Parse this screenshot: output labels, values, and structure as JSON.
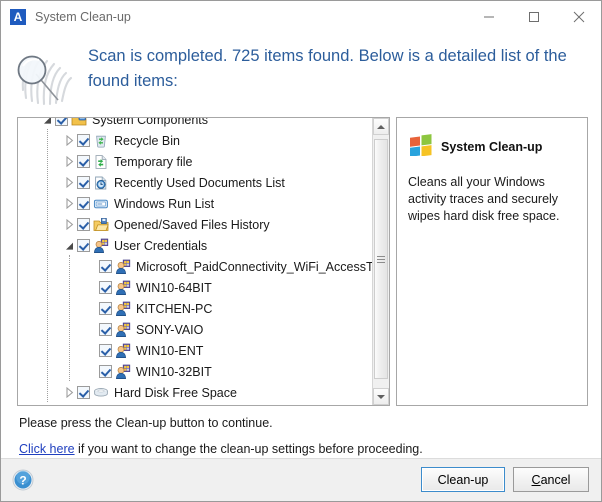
{
  "window": {
    "title": "System Clean-up",
    "app_icon": "letter-a-icon",
    "caption": {
      "minimize": "minimize-icon",
      "maximize": "maximize-icon",
      "close": "close-icon"
    }
  },
  "header": {
    "icon": "fingerprint-magnifier-icon",
    "message": "Scan is completed. 725 items found. Below is a detailed list of the found items:",
    "items_found": 725,
    "text_color": "#2c5d9b"
  },
  "tree": {
    "rows": [
      {
        "label": "System Components",
        "depth": 0,
        "expander": "expanded",
        "checked": true,
        "icon": "system-components-icon",
        "clipped": true
      },
      {
        "label": "Recycle Bin",
        "depth": 1,
        "expander": "collapsed",
        "checked": true,
        "icon": "recycle-bin-icon"
      },
      {
        "label": "Temporary file",
        "depth": 1,
        "expander": "collapsed",
        "checked": true,
        "icon": "temporary-file-icon"
      },
      {
        "label": "Recently Used Documents List",
        "depth": 1,
        "expander": "collapsed",
        "checked": true,
        "icon": "recent-documents-icon"
      },
      {
        "label": "Windows Run List",
        "depth": 1,
        "expander": "collapsed",
        "checked": true,
        "icon": "run-list-icon"
      },
      {
        "label": "Opened/Saved Files History",
        "depth": 1,
        "expander": "collapsed",
        "checked": true,
        "icon": "opened-saved-files-icon"
      },
      {
        "label": "User Credentials",
        "depth": 1,
        "expander": "expanded",
        "checked": true,
        "icon": "user-credentials-icon"
      },
      {
        "label": "Microsoft_PaidConnectivity_WiFi_AccessToken",
        "depth": 2,
        "expander": "none",
        "checked": true,
        "icon": "user-credential-item-icon"
      },
      {
        "label": "WIN10-64BIT",
        "depth": 2,
        "expander": "none",
        "checked": true,
        "icon": "user-credential-item-icon"
      },
      {
        "label": "KITCHEN-PC",
        "depth": 2,
        "expander": "none",
        "checked": true,
        "icon": "user-credential-item-icon"
      },
      {
        "label": "SONY-VAIO",
        "depth": 2,
        "expander": "none",
        "checked": true,
        "icon": "user-credential-item-icon"
      },
      {
        "label": "WIN10-ENT",
        "depth": 2,
        "expander": "none",
        "checked": true,
        "icon": "user-credential-item-icon"
      },
      {
        "label": "WIN10-32BIT",
        "depth": 2,
        "expander": "none",
        "checked": true,
        "icon": "user-credential-item-icon"
      },
      {
        "label": "Hard Disk Free Space",
        "depth": 1,
        "expander": "collapsed",
        "checked": true,
        "icon": "hard-disk-icon",
        "clipped": true
      }
    ],
    "scrollbar": {
      "up_arrow": "scroll-up-icon",
      "down_arrow": "scroll-down-icon",
      "thumb": "scroll-thumb"
    }
  },
  "info": {
    "icon": "windows-flag-icon",
    "title": "System Clean-up",
    "description": "Cleans all your Windows activity traces and securely wipes hard disk free space."
  },
  "footer": {
    "instruction": "Please press the Clean-up button to continue.",
    "link_text": "Click here",
    "link_suffix": " if you want to change the clean-up settings before proceeding."
  },
  "bottom_bar": {
    "help_icon": "help-question-icon",
    "cleanup_button": "Clean-up",
    "cancel_button_prefix": "C",
    "cancel_button_rest": "ancel",
    "default_button": "Clean-up",
    "accent_color": "#3c8ccc"
  }
}
